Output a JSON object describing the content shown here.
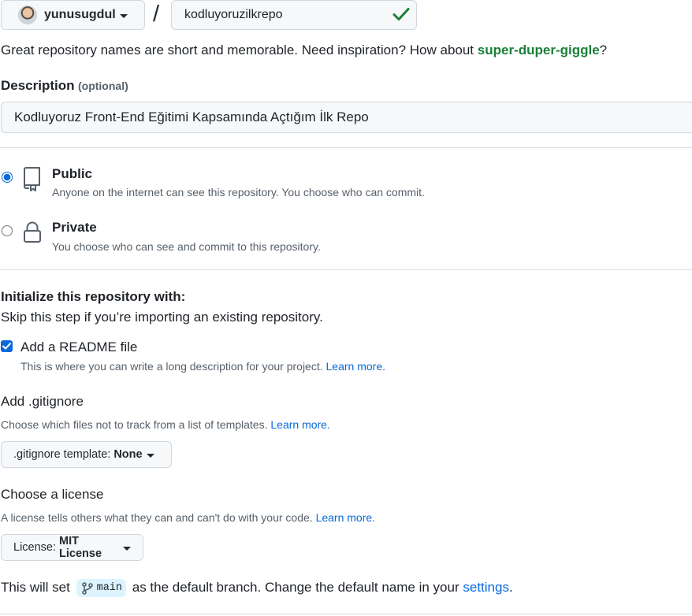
{
  "owner": {
    "name": "yunusugdul"
  },
  "separator": "/",
  "repo": {
    "value": "kodluyoruzilkrepo"
  },
  "name_hint": {
    "prefix": "Great repository names are short and memorable. Need inspiration? How about ",
    "suggestion": "super-duper-giggle",
    "suffix": "?"
  },
  "description": {
    "label": "Description",
    "optional": "(optional)",
    "value": "Kodluyoruz Front-End Eğitimi Kapsamında Açtığım İlk Repo"
  },
  "visibility": {
    "public": {
      "title": "Public",
      "subtitle": "Anyone on the internet can see this repository. You choose who can commit.",
      "checked": true
    },
    "private": {
      "title": "Private",
      "subtitle": "You choose who can see and commit to this repository.",
      "checked": false
    }
  },
  "init": {
    "title": "Initialize this repository with:",
    "subtitle": "Skip this step if you’re importing an existing repository.",
    "readme": {
      "label": "Add a README file",
      "desc": "This is where you can write a long description for your project.",
      "link": "Learn more.",
      "checked": true
    }
  },
  "gitignore": {
    "title": "Add .gitignore",
    "desc": "Choose which files not to track from a list of templates.",
    "link": "Learn more.",
    "button_prefix": ".gitignore template:",
    "button_value": "None"
  },
  "license": {
    "title": "Choose a license",
    "desc": "A license tells others what they can and can't do with your code.",
    "link": "Learn more.",
    "button_prefix": "License:",
    "button_value": "MIT License"
  },
  "branch": {
    "prefix": "This will set",
    "name": "main",
    "middle": "as the default branch. Change the default name in your",
    "link": "settings",
    "suffix": "."
  },
  "colors": {
    "accent": "#0969da",
    "success": "#1a7f37",
    "border": "#d0d7de",
    "muted": "#57606a"
  }
}
